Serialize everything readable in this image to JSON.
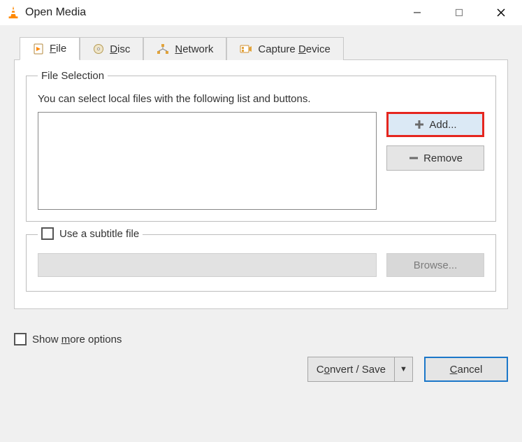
{
  "titlebar": {
    "title": "Open Media"
  },
  "tabs": {
    "file": {
      "prefix": "F",
      "rest": "ile"
    },
    "disc": {
      "prefix": "D",
      "rest": "isc"
    },
    "network": {
      "prefix": "N",
      "rest": "etwork"
    },
    "capture": {
      "before": "Capture ",
      "u": "D",
      "after": "evice"
    }
  },
  "file_section": {
    "legend": "File Selection",
    "instruction": "You can select local files with the following list and buttons.",
    "add_label": "Add...",
    "remove_label": "Remove"
  },
  "subtitle": {
    "label": "Use a subtitle file",
    "browse_label": "Browse..."
  },
  "footer": {
    "more_before": "Show ",
    "more_u": "m",
    "more_after": "ore options",
    "convert_before": "C",
    "convert_u": "o",
    "convert_after": "nvert / Save",
    "cancel_u": "C",
    "cancel_after": "ancel"
  }
}
